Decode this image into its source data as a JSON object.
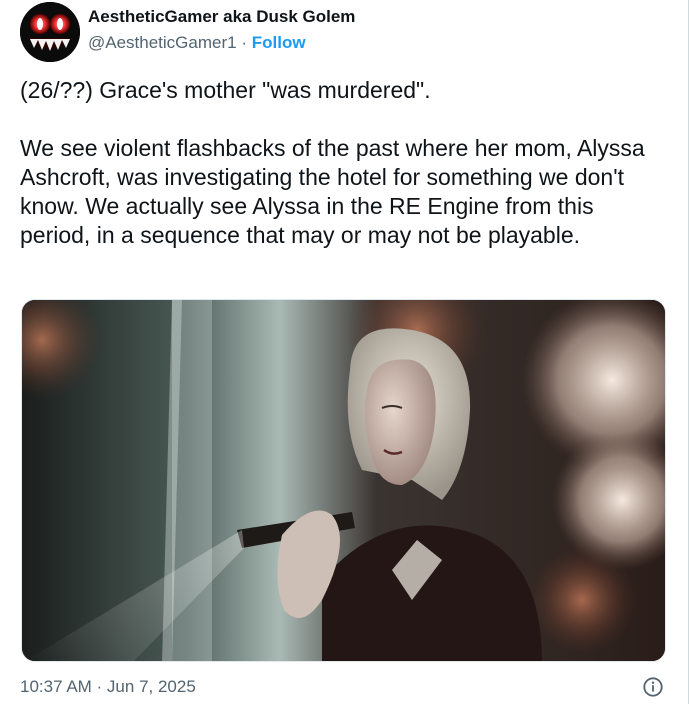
{
  "author": {
    "display_name": "AestheticGamer aka Dusk Golem",
    "handle": "@AestheticGamer1",
    "separator": "·",
    "follow_label": "Follow"
  },
  "tweet": {
    "paragraphs": [
      "(26/??) Grace's mother \"was murdered\".",
      "We see violent flashbacks of the past where her mom, Alyssa Ashcroft, was investigating the hotel for something we don't know. We actually see Alyssa in the RE Engine from this period, in a sequence that may or may not be playable."
    ]
  },
  "footer": {
    "timestamp": "10:37 AM · Jun 7, 2025"
  },
  "colors": {
    "accent": "#1d9bf0",
    "text": "#0f1419",
    "secondary": "#536471"
  },
  "icons": {
    "info": "info-circle-icon"
  }
}
